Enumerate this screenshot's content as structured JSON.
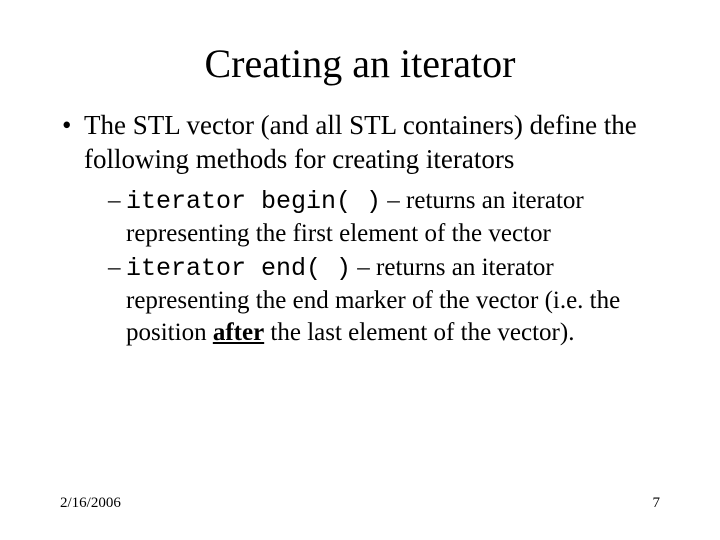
{
  "title": "Creating an iterator",
  "main_bullet": "The STL vector (and all STL containers) define the following methods for creating iterators",
  "sub1": {
    "code": "iterator begin( )",
    "rest": " – returns an iterator representing the first element of the vector"
  },
  "sub2": {
    "code": "iterator end( )",
    "rest_a": " – returns an iterator representing the end marker of the vector (i.e. the position ",
    "emph": "after",
    "rest_b": " the last element of the vector)."
  },
  "footer": {
    "date": "2/16/2006",
    "page": "7"
  }
}
